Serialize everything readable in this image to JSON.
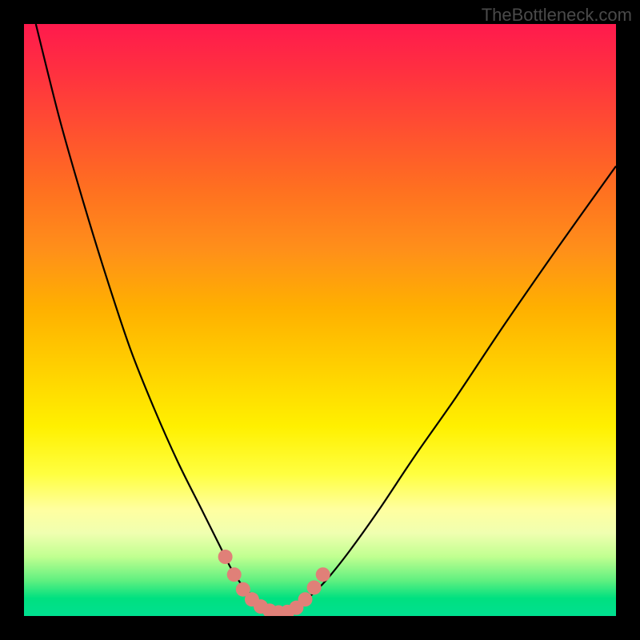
{
  "watermark": "TheBottleneck.com",
  "chart_data": {
    "type": "line",
    "title": "",
    "xlabel": "",
    "ylabel": "",
    "xlim": [
      0,
      100
    ],
    "ylim": [
      0,
      100
    ],
    "note": "Axes have no visible numeric ticks or labels in the source image; values are normalized 0-100 estimates read from pixel position.",
    "series": [
      {
        "name": "left-curve",
        "x": [
          2,
          6,
          10,
          14,
          18,
          22,
          26,
          30,
          33,
          35,
          37,
          39,
          41
        ],
        "y": [
          100,
          84,
          70,
          57,
          45,
          35,
          26,
          18,
          12,
          8,
          5,
          3,
          1
        ]
      },
      {
        "name": "right-curve",
        "x": [
          46,
          48,
          51,
          55,
          60,
          66,
          73,
          81,
          90,
          100
        ],
        "y": [
          1,
          3,
          6,
          11,
          18,
          27,
          37,
          49,
          62,
          76
        ]
      },
      {
        "name": "valley-floor",
        "x": [
          41,
          42,
          43,
          44,
          45,
          46
        ],
        "y": [
          1,
          0.5,
          0.4,
          0.4,
          0.5,
          1
        ]
      }
    ],
    "markers": {
      "name": "highlighted-points",
      "color": "#e08078",
      "points": [
        {
          "x": 34,
          "y": 10
        },
        {
          "x": 35.5,
          "y": 7
        },
        {
          "x": 37,
          "y": 4.5
        },
        {
          "x": 38.5,
          "y": 2.8
        },
        {
          "x": 40,
          "y": 1.6
        },
        {
          "x": 41.5,
          "y": 0.9
        },
        {
          "x": 43,
          "y": 0.6
        },
        {
          "x": 44.5,
          "y": 0.7
        },
        {
          "x": 46,
          "y": 1.4
        },
        {
          "x": 47.5,
          "y": 2.8
        },
        {
          "x": 49,
          "y": 4.8
        },
        {
          "x": 50.5,
          "y": 7
        }
      ]
    }
  }
}
